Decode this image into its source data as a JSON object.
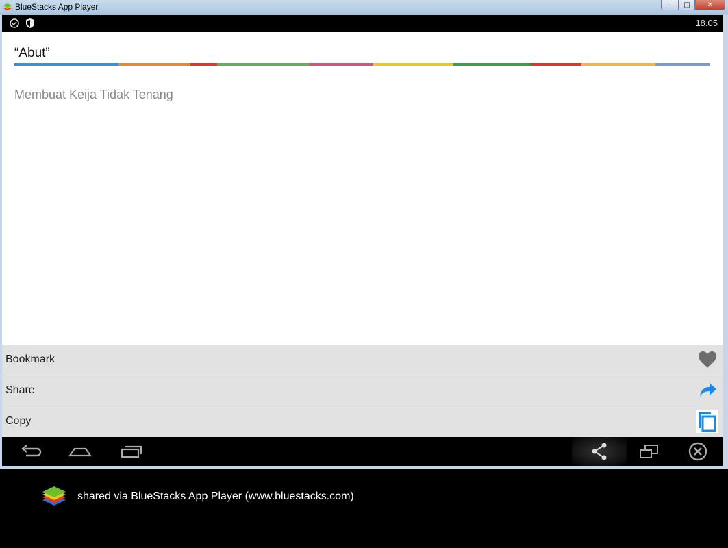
{
  "window": {
    "title": "BlueStacks App Player",
    "buttons": {
      "minimize": "–",
      "maximize": "□",
      "close": "✕"
    }
  },
  "status_bar": {
    "time": "18.05"
  },
  "content": {
    "quote_title": "“Abut”",
    "meaning": "Membuat Keija Tidak Tenang"
  },
  "actions": [
    {
      "label": "Bookmark",
      "icon": "heart-icon"
    },
    {
      "label": "Share",
      "icon": "share-arrow-icon"
    },
    {
      "label": "Copy",
      "icon": "copy-icon"
    }
  ],
  "navigation": [
    "back-icon",
    "home-icon",
    "recent-apps-icon",
    "share-icon",
    "window-icon",
    "close-circle-icon"
  ],
  "footer": {
    "caption": "shared via BlueStacks App Player (www.bluestacks.com)"
  },
  "colors": {
    "accent_blue": "#1e88e5",
    "heart_gray": "#6d6d6d",
    "stripe": [
      "#3d8fd1",
      "#e48b3b",
      "#d43b33",
      "#6aac5b",
      "#c9587a",
      "#e8c82d",
      "#3d9a4d",
      "#d43b33",
      "#e8b84a",
      "#7d9ac8"
    ]
  }
}
